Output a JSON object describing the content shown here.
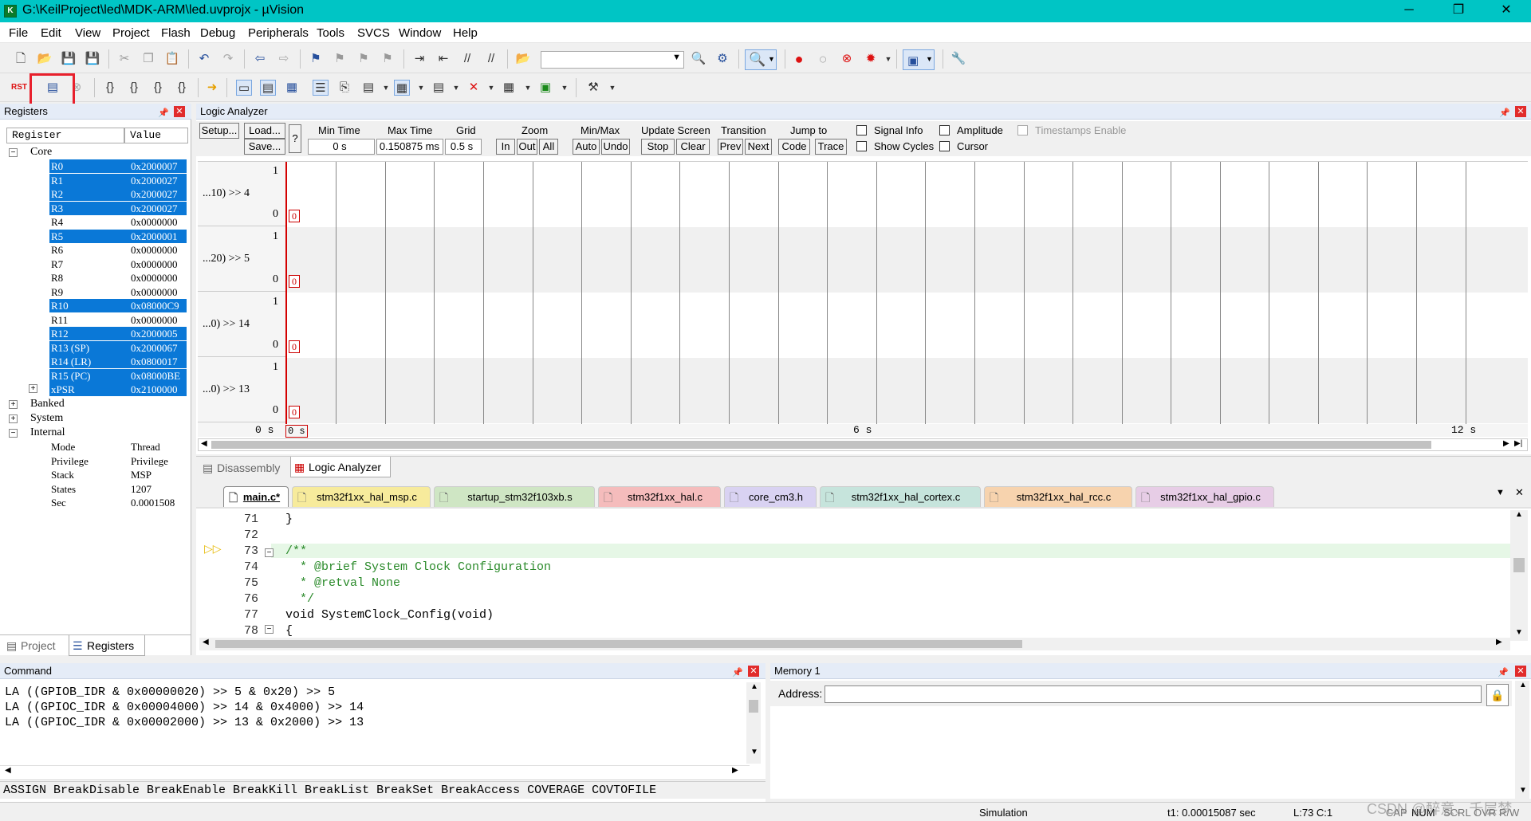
{
  "window": {
    "title": "G:\\KeilProject\\led\\MDK-ARM\\led.uvprojx - µVision",
    "app_icon": "keil-icon",
    "min": "─",
    "max": "❐",
    "close": "✕"
  },
  "menu": [
    "File",
    "Edit",
    "View",
    "Project",
    "Flash",
    "Debug",
    "Peripherals",
    "Tools",
    "SVCS",
    "Window",
    "Help"
  ],
  "registers_panel": {
    "title": "Registers",
    "col_register": "Register",
    "col_value": "Value",
    "core": "Core",
    "rows": [
      {
        "name": "R0",
        "value": "0x2000007",
        "selected": true
      },
      {
        "name": "R1",
        "value": "0x2000027",
        "selected": true
      },
      {
        "name": "R2",
        "value": "0x2000027",
        "selected": true
      },
      {
        "name": "R3",
        "value": "0x2000027",
        "selected": true
      },
      {
        "name": "R4",
        "value": "0x0000000",
        "selected": false
      },
      {
        "name": "R5",
        "value": "0x2000001",
        "selected": true
      },
      {
        "name": "R6",
        "value": "0x0000000",
        "selected": false
      },
      {
        "name": "R7",
        "value": "0x0000000",
        "selected": false
      },
      {
        "name": "R8",
        "value": "0x0000000",
        "selected": false
      },
      {
        "name": "R9",
        "value": "0x0000000",
        "selected": false
      },
      {
        "name": "R10",
        "value": "0x08000C9",
        "selected": true
      },
      {
        "name": "R11",
        "value": "0x0000000",
        "selected": false
      },
      {
        "name": "R12",
        "value": "0x2000005",
        "selected": true
      },
      {
        "name": "R13 (SP)",
        "value": "0x2000067",
        "selected": true
      },
      {
        "name": "R14 (LR)",
        "value": "0x0800017",
        "selected": true
      },
      {
        "name": "R15 (PC)",
        "value": "0x08000BE",
        "selected": true
      },
      {
        "name": "xPSR",
        "value": "0x2100000",
        "selected": true
      }
    ],
    "banked": "Banked",
    "system": "System",
    "internal": "Internal",
    "internal_rows": [
      {
        "name": "Mode",
        "value": "Thread"
      },
      {
        "name": "Privilege",
        "value": "Privilege"
      },
      {
        "name": "Stack",
        "value": "MSP"
      },
      {
        "name": "States",
        "value": "1207"
      },
      {
        "name": "Sec",
        "value": "0.0001508"
      }
    ],
    "tab_project": "Project",
    "tab_registers": "Registers"
  },
  "logic_analyzer": {
    "title": "Logic Analyzer",
    "setup": "Setup...",
    "load": "Load...",
    "save": "Save...",
    "help": "?",
    "min_time_label": "Min Time",
    "min_time": "0 s",
    "max_time_label": "Max Time",
    "max_time": "0.150875 ms",
    "grid_label": "Grid",
    "grid": "0.5 s",
    "zoom_label": "Zoom",
    "zoom_in": "In",
    "zoom_out": "Out",
    "zoom_all": "All",
    "minmax_label": "Min/Max",
    "auto": "Auto",
    "undo": "Undo",
    "update_label": "Update Screen",
    "stop": "Stop",
    "clear": "Clear",
    "transition_label": "Transition",
    "prev": "Prev",
    "next": "Next",
    "jump_label": "Jump to",
    "code": "Code",
    "trace": "Trace",
    "signal_info": "Signal Info",
    "show_cycles": "Show Cycles",
    "amplitude": "Amplitude",
    "cursor": "Cursor",
    "timestamps": "Timestamps Enable",
    "signals": [
      {
        "label": "...10) >> 4",
        "high": "1",
        "low": "0"
      },
      {
        "label": "...20) >> 5",
        "high": "1",
        "low": "0"
      },
      {
        "label": "...0) >> 14",
        "high": "1",
        "low": "0"
      },
      {
        "label": "...0) >> 13",
        "high": "1",
        "low": "0"
      }
    ],
    "zero_marker": "0",
    "time_marker": "0 s",
    "axis_left": "0 s",
    "axis_mid": "6 s",
    "axis_right": "12 s",
    "tab_disassembly": "Disassembly",
    "tab_logic": "Logic Analyzer"
  },
  "editor": {
    "files": [
      {
        "name": "main.c*",
        "color": "#ffffff"
      },
      {
        "name": "stm32f1xx_hal_msp.c",
        "color": "#f7eb9c"
      },
      {
        "name": "startup_stm32f103xb.s",
        "color": "#cfe6c4"
      },
      {
        "name": "stm32f1xx_hal.c",
        "color": "#f5bcbc"
      },
      {
        "name": "core_cm3.h",
        "color": "#d9d2f2"
      },
      {
        "name": "stm32f1xx_hal_cortex.c",
        "color": "#c6e4dc"
      },
      {
        "name": "stm32f1xx_hal_rcc.c",
        "color": "#f7d3ae"
      },
      {
        "name": "stm32f1xx_hal_gpio.c",
        "color": "#e7cde6"
      }
    ],
    "lines": [
      {
        "n": "71",
        "text": "}",
        "kind": "code"
      },
      {
        "n": "72",
        "text": "",
        "kind": "code"
      },
      {
        "n": "73",
        "text": "/**",
        "kind": "comment"
      },
      {
        "n": "74",
        "text": "  * @brief System Clock Configuration",
        "kind": "comment"
      },
      {
        "n": "75",
        "text": "  * @retval None",
        "kind": "comment"
      },
      {
        "n": "76",
        "text": "  */",
        "kind": "comment"
      },
      {
        "n": "77",
        "text": "void SystemClock_Config(void)",
        "kind": "code"
      },
      {
        "n": "78",
        "text": "{",
        "kind": "code"
      }
    ]
  },
  "command": {
    "title": "Command",
    "lines": [
      "LA ((GPIOB_IDR & 0x00000020) >> 5 & 0x20) >> 5",
      "LA ((GPIOC_IDR & 0x00004000) >> 14 & 0x4000) >> 14",
      "LA ((GPIOC_IDR & 0x00002000) >> 13 & 0x2000) >> 13"
    ],
    "prompt": ">",
    "hints": "ASSIGN BreakDisable BreakEnable BreakKill BreakList BreakSet BreakAccess COVERAGE COVTOFILE"
  },
  "memory": {
    "title": "Memory 1",
    "address_label": "Address:",
    "address_value": ""
  },
  "status": {
    "mode": "Simulation",
    "t1": "t1: 0.00015087 sec",
    "position": "L:73 C:1",
    "watermark": "CSDN @醉意、千层梦",
    "caps": "CAP",
    "num": "NUM",
    "scrl": "SCRL",
    "ovr": "OVR",
    "rw": "R/W"
  },
  "colors": {
    "titlebar": "#00c5c5",
    "selection": "#0a78d7",
    "close_red": "#e12c2c",
    "highlight_red": "#e8202c",
    "exec_line": "#e6f7e6",
    "comment_green": "#2a8a2a",
    "keyword_blue": "#0000cc"
  }
}
